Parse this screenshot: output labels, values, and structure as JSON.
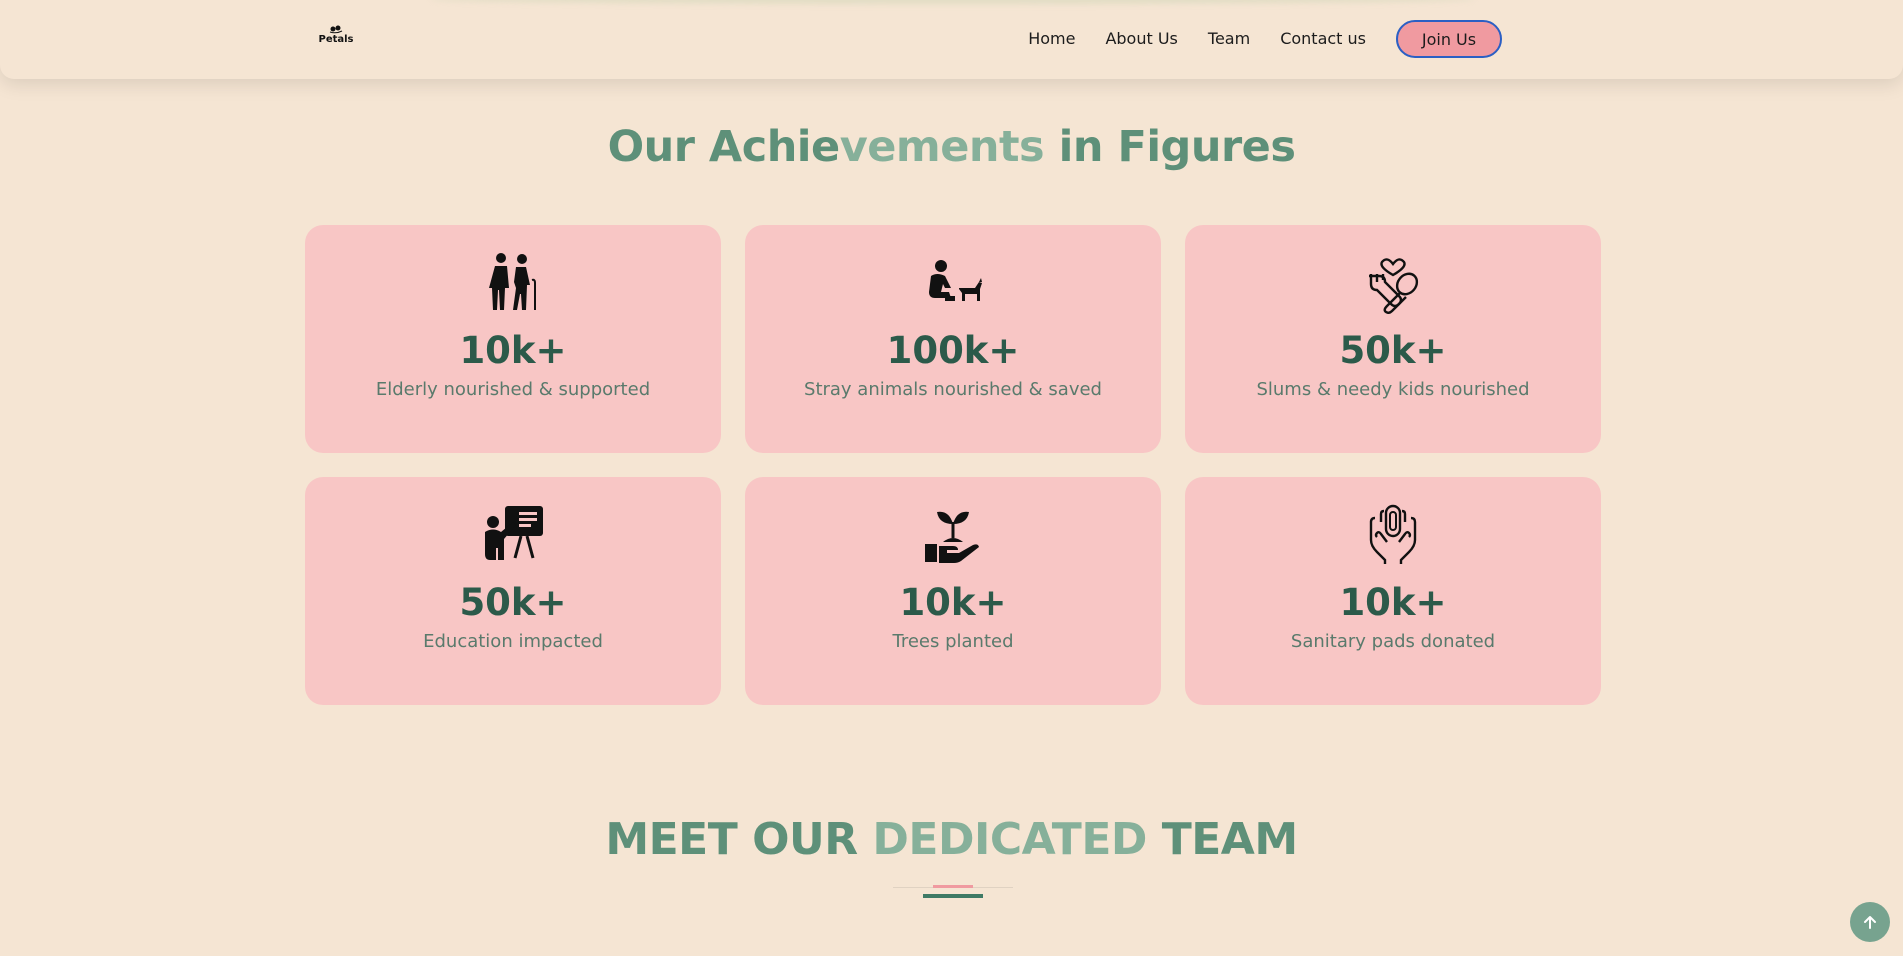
{
  "header": {
    "logo_text": "Petals",
    "nav": [
      "Home",
      "About Us",
      "Team",
      "Contact us"
    ],
    "join_label": "Join Us"
  },
  "achievements": {
    "title_part1": "Our Achie",
    "title_part2": "vements ",
    "title_part3": "in Figures",
    "cards": [
      {
        "icon": "elderly-couple-icon",
        "value": "10k+",
        "label": "Elderly nourished & supported"
      },
      {
        "icon": "person-feeding-dog-icon",
        "value": "100k+",
        "label": "Stray animals nourished & saved"
      },
      {
        "icon": "food-care-icon",
        "value": "50k+",
        "label": "Slums & needy kids nourished"
      },
      {
        "icon": "teacher-board-icon",
        "value": "50k+",
        "label": "Education impacted"
      },
      {
        "icon": "hand-plant-icon",
        "value": "10k+",
        "label": "Trees planted"
      },
      {
        "icon": "sanitary-pad-hands-icon",
        "value": "10k+",
        "label": "Sanitary pads donated"
      }
    ]
  },
  "team": {
    "title_part1": "MEET OUR ",
    "title_part2": "DEDICATED ",
    "title_part3": "TEAM"
  },
  "colors": {
    "background": "#f5e5d3",
    "card": "#f8c6c5",
    "accent_green": "#5e9079",
    "accent_pink": "#f09aa0",
    "button_border": "#2b5fc4"
  }
}
